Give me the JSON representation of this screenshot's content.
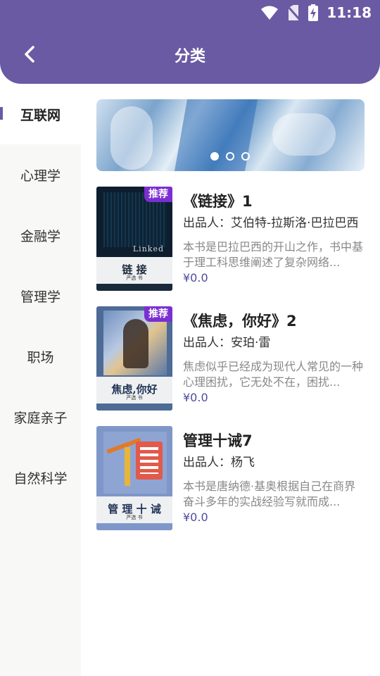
{
  "status_bar": {
    "time": "11:18",
    "icons": [
      "wifi-icon",
      "no-sim-icon",
      "battery-charging-icon"
    ]
  },
  "header": {
    "title": "分类",
    "back_icon": "chevron-left-icon"
  },
  "colors": {
    "accent": "#6a5aa3",
    "badge": "#7a2fd0",
    "price": "#4f4aa0"
  },
  "sidebar": {
    "items": [
      {
        "label": "互联网",
        "active": true
      },
      {
        "label": "心理学"
      },
      {
        "label": "金融学"
      },
      {
        "label": "管理学"
      },
      {
        "label": "职场"
      },
      {
        "label": "家庭亲子"
      },
      {
        "label": "自然科学"
      }
    ]
  },
  "banner": {
    "dots": 3,
    "active_dot": 1
  },
  "books": [
    {
      "title": "《链接》1",
      "author": "出品人：艾伯特-拉斯洛·巴拉巴西",
      "description": "本书是巴拉巴西的开山之作，书中基于理工科思维阐述了复杂网络...",
      "price": "¥0.0",
      "badge": "推荐",
      "cover": {
        "word": "Linked",
        "title": "链 接",
        "sub": "严选 书"
      }
    },
    {
      "title": "《焦虑，你好》2",
      "author": "出品人：安珀·雷",
      "description": "焦虑似乎已经成为现代人常见的一种心理困扰，它无处不在，困扰...",
      "price": "¥0.0",
      "badge": "推荐",
      "cover": {
        "title": "焦虑,你好",
        "sub": "严选 书"
      }
    },
    {
      "title": "管理十诫7",
      "author": "出品人：杨飞",
      "description": "本书是唐纳德·基奥根据自己在商界奋斗多年的实战经验写就而成...",
      "price": "¥0.0",
      "badge": "",
      "cover": {
        "title": "管 理 十 诫",
        "sub": "严选 书"
      }
    }
  ]
}
